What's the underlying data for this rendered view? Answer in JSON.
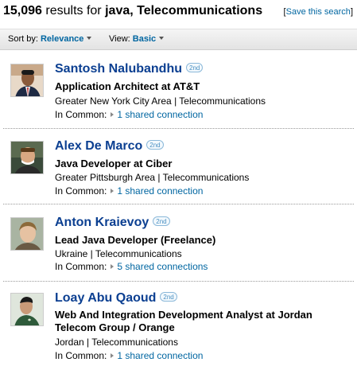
{
  "header": {
    "count": "15,096",
    "results_for": "results for",
    "query": "java, Telecommunications",
    "save_search": "Save this search"
  },
  "sortbar": {
    "sort_label": "Sort by:",
    "sort_value": "Relevance",
    "view_label": "View:",
    "view_value": "Basic"
  },
  "results": [
    {
      "name": "Santosh Nalubandhu",
      "degree": "2nd",
      "headline": "Application Architect at AT&T",
      "location": "Greater New York City Area | Telecommunications",
      "common_label": "In Common:",
      "common_link": "1 shared connection"
    },
    {
      "name": "Alex De Marco",
      "degree": "2nd",
      "headline": "Java Developer at Ciber",
      "location": "Greater Pittsburgh Area | Telecommunications",
      "common_label": "In Common:",
      "common_link": "1 shared connection"
    },
    {
      "name": "Anton Kraievoy",
      "degree": "2nd",
      "headline": "Lead Java Developer (Freelance)",
      "location": "Ukraine | Telecommunications",
      "common_label": "In Common:",
      "common_link": "5 shared connections"
    },
    {
      "name": "Loay Abu Qaoud",
      "degree": "2nd",
      "headline": "Web And Integration Development Analyst at Jordan Telecom Group / Orange",
      "location": "Jordan | Telecommunications",
      "common_label": "In Common:",
      "common_link": "1 shared connection"
    }
  ]
}
